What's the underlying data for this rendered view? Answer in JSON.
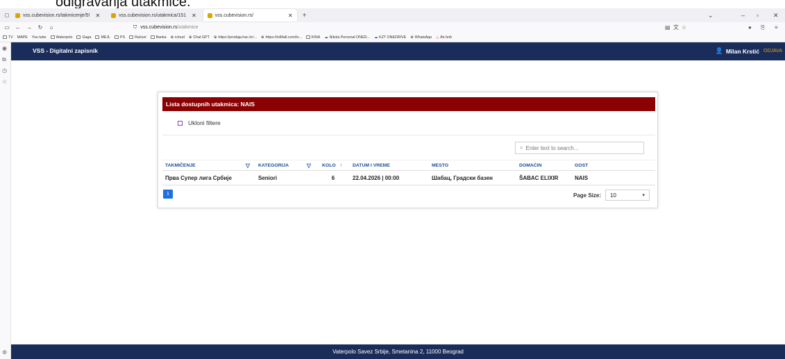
{
  "doc_caption": "odigravanja utakmice.",
  "browser": {
    "tabs": [
      {
        "label": "vss.cubevision.rs/takmicenje/5!"
      },
      {
        "label": "vss.cubevision.rs/utakmica/151"
      },
      {
        "label": "vss.cubevision.rs/"
      }
    ],
    "url_host": "vss.cubevision.rs",
    "url_path": "/utakmice",
    "bookmarks": [
      "TV",
      "MAPE",
      "You tube",
      "Waterpolo",
      "Gaga",
      "MEJL",
      "PS",
      "Računi",
      "Banka",
      "icloud",
      "Chat GPT",
      "https://prodaja.hac.hr/...",
      "https://toll4all.com/lo...",
      "KINA",
      "Nikola Personal ONED...",
      "KZT ONEDRIVE",
      "WhatsApp",
      "Air bnb"
    ]
  },
  "app": {
    "title": "VSS - Digitalni zapisnik",
    "user_name": "Milan Krstić",
    "logout_label": "ODJAVA"
  },
  "card": {
    "heading": "Lista dostupnih utakmica: NAIS",
    "clear_filters_label": "Ukloni filtere",
    "search_placeholder": "Enter text to search..."
  },
  "table": {
    "columns": [
      "TAKMIČENJE",
      "KATEGORIJA",
      "KOLO",
      "DATUM I VREME",
      "MESTO",
      "DOMAĆIN",
      "GOST"
    ],
    "rows": [
      [
        "Прва Супер лига Србије",
        "Seniori",
        "6",
        "22.04.2026 | 00:00",
        "Шабац, Градски базен",
        "ŠABAC ELIXIR",
        "NAIS"
      ]
    ]
  },
  "pager": {
    "current_page": "1",
    "page_size_label": "Page Size:",
    "page_size_value": "10"
  },
  "footer": {
    "text": "Vaterpolo Savez Srbije, Smetanina 2, 11000 Beograd"
  },
  "colors": {
    "header_navy": "#1a2d5a",
    "card_head_red": "#8b0000",
    "accent_blue": "#1e6fe0",
    "logout_orange": "#e7a11a"
  }
}
